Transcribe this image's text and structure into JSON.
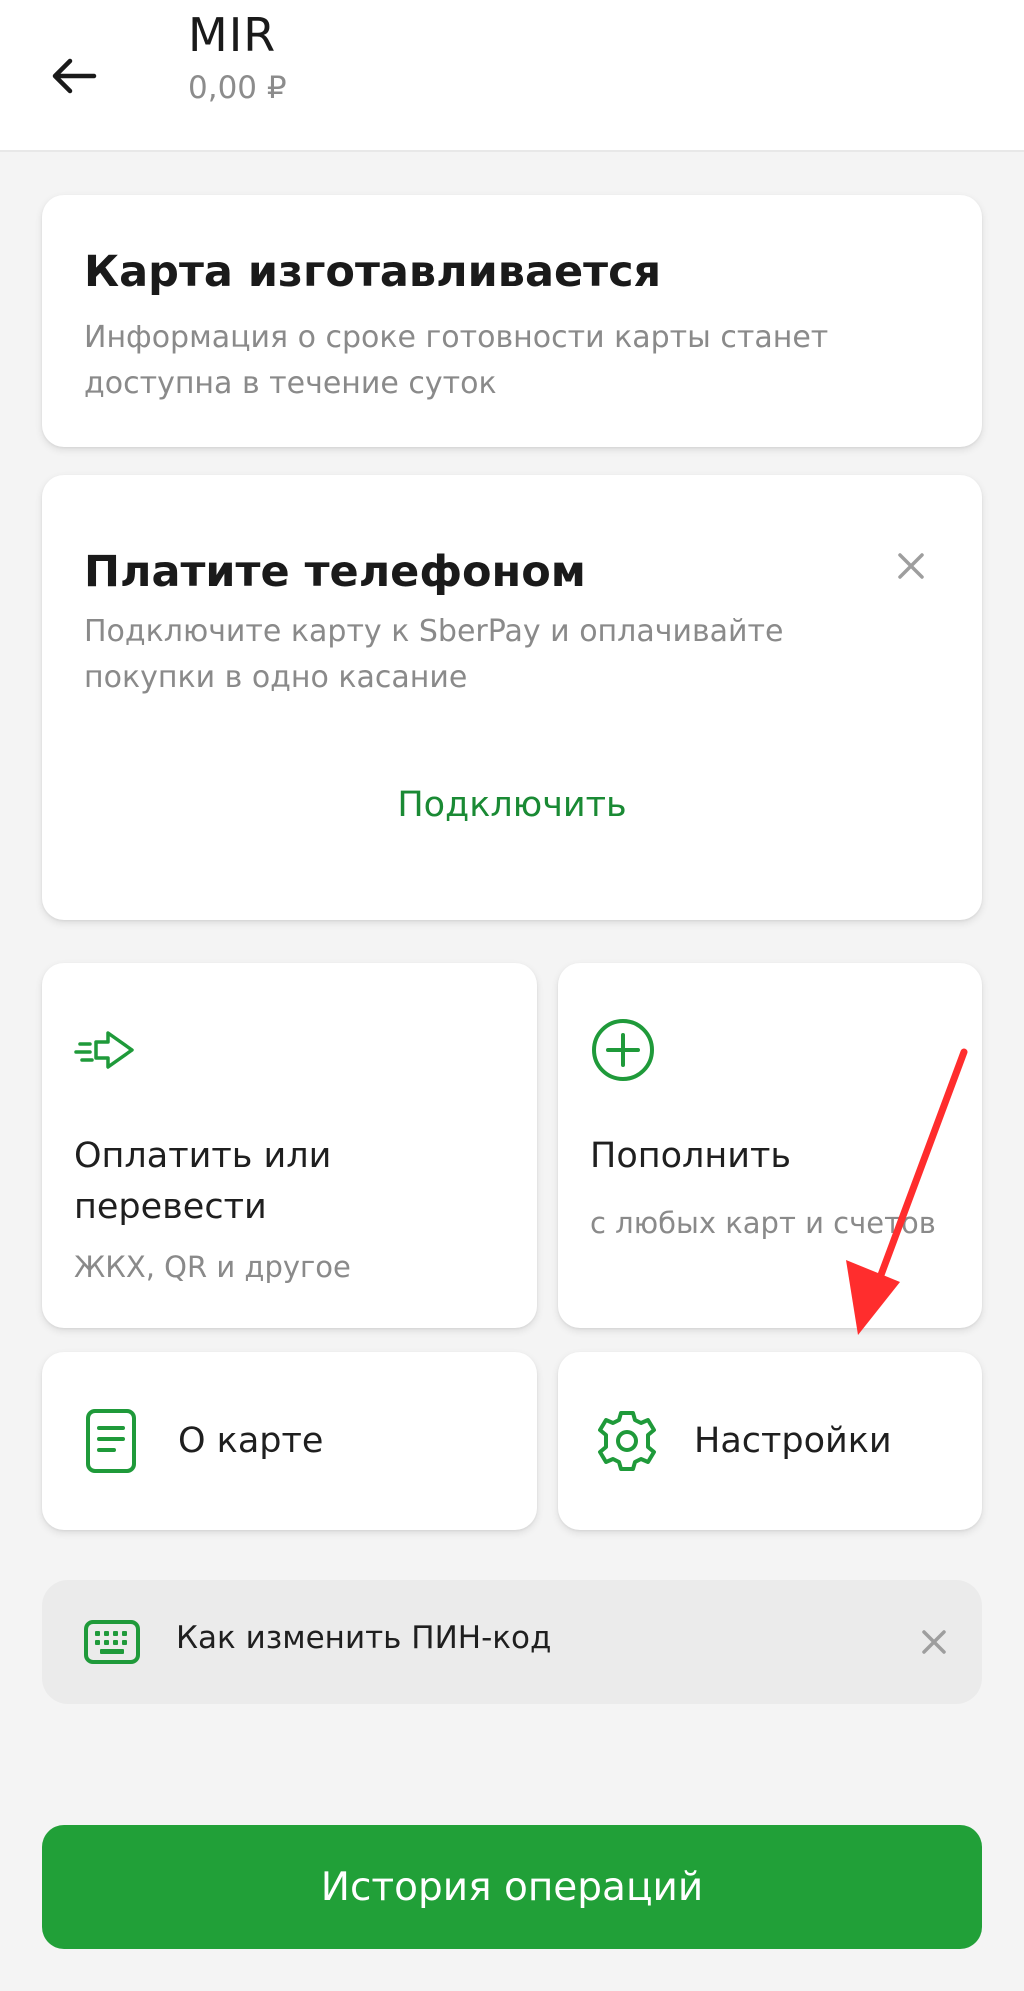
{
  "colors": {
    "accent_green": "#21a038",
    "link_green": "#1a8a34",
    "icon_green": "#1f9a3a",
    "background": "#f4f4f4",
    "annotation_red": "#ff2d2d"
  },
  "header": {
    "title": "MIR",
    "balance": "0,00 ₽",
    "back_icon": "arrow-left-icon"
  },
  "status_card": {
    "title": "Карта изготавливается",
    "description": "Информация о сроке готовности карты станет доступна в течение суток"
  },
  "promo_card": {
    "title": "Платите телефоном",
    "description": "Подключите карту к SberPay и оплачивайте покупки в одно касание",
    "action": "Подключить",
    "close_icon": "close-icon"
  },
  "tiles": {
    "pay": {
      "title": "Оплатить или перевести",
      "subtitle": "ЖКХ, QR и другое",
      "icon": "send-arrow-icon"
    },
    "topup": {
      "title": "Пополнить",
      "subtitle": "с любых карт и счетов",
      "icon": "plus-circle-icon"
    },
    "about": {
      "label": "О карте",
      "icon": "document-icon"
    },
    "settings": {
      "label": "Настройки",
      "icon": "gear-icon"
    }
  },
  "pin_tip": {
    "label": "Как изменить ПИН-код",
    "icon": "keyboard-icon",
    "close_icon": "close-icon"
  },
  "history_button": {
    "label": "История операций"
  }
}
